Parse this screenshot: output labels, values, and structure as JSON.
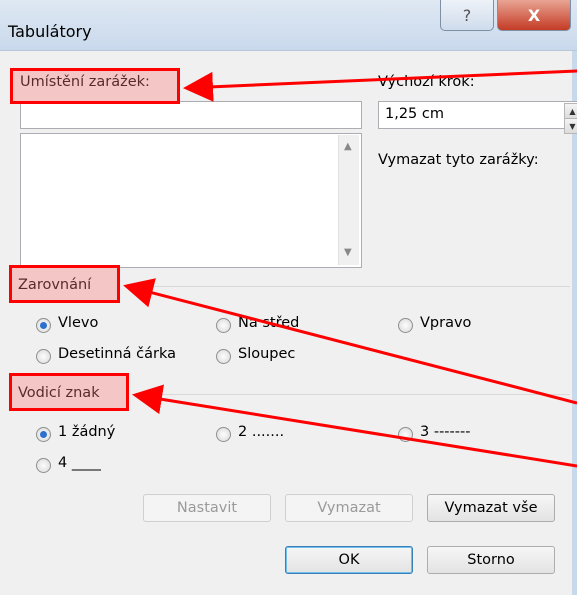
{
  "window": {
    "title": "Tabulátory"
  },
  "titlebar": {
    "help": "?",
    "close": "X"
  },
  "left": {
    "positions_label": "Umístění zarážek:",
    "position_value": ""
  },
  "right": {
    "default_step_label": "Výchozí krok:",
    "default_step_value": "1,25 cm",
    "clear_label": "Vymazat tyto zarážky:"
  },
  "alignment": {
    "heading": "Zarovnání",
    "options": [
      "Vlevo",
      "Na střed",
      "Vpravo",
      "Desetinná čárka",
      "Sloupec"
    ],
    "selected": "Vlevo"
  },
  "leader": {
    "heading": "Vodicí znak",
    "options": [
      "1 žádný",
      "2 .......",
      "3 -------",
      "4 ____"
    ],
    "selected": "1 žádný"
  },
  "buttons": {
    "set": "Nastavit",
    "clear": "Vymazat",
    "clear_all": "Vymazat vše",
    "ok": "OK",
    "cancel": "Storno"
  },
  "colors": {
    "highlight": "#ff0000",
    "selected_radio": "#2b6fd0"
  }
}
